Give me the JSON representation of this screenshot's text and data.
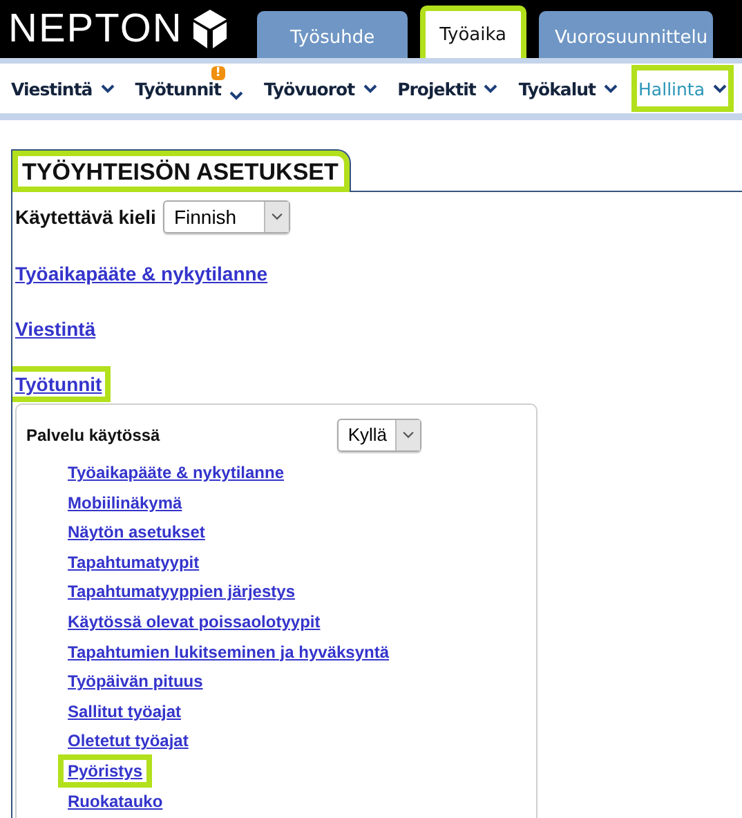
{
  "header": {
    "logo": "NEPTON",
    "tabs": [
      {
        "label": "Työsuhde",
        "selected": false,
        "highlighted": false
      },
      {
        "label": "Työaika",
        "selected": true,
        "highlighted": true
      },
      {
        "label": "Vuorosuunnittelu",
        "selected": false,
        "highlighted": false
      }
    ]
  },
  "menu": [
    {
      "label": "Viestintä",
      "selected": false,
      "highlighted": false
    },
    {
      "label": "Työtunnit",
      "selected": false,
      "highlighted": false,
      "badge": "!"
    },
    {
      "label": "Työvuorot",
      "selected": false,
      "highlighted": false
    },
    {
      "label": "Projektit",
      "selected": false,
      "highlighted": false
    },
    {
      "label": "Työkalut",
      "selected": false,
      "highlighted": false
    },
    {
      "label": "Hallinta",
      "selected": true,
      "highlighted": true
    }
  ],
  "panel": {
    "title": "TYÖYHTEISÖN ASETUKSET",
    "title_highlighted": true,
    "language": {
      "label": "Käytettävä kieli",
      "value": "Finnish"
    },
    "sections": [
      {
        "label": "Työaikapääte & nykytilanne",
        "highlighted": false
      },
      {
        "label": "Viestintä",
        "highlighted": false
      },
      {
        "label": "Työtunnit",
        "highlighted": true
      }
    ],
    "subsection": {
      "service": {
        "label": "Palvelu käytössä",
        "value": "Kyllä"
      },
      "links": [
        {
          "label": "Työaikapääte & nykytilanne",
          "highlighted": false
        },
        {
          "label": "Mobiilinäkymä",
          "highlighted": false
        },
        {
          "label": "Näytön asetukset",
          "highlighted": false
        },
        {
          "label": "Tapahtumatyypit",
          "highlighted": false
        },
        {
          "label": "Tapahtumatyyppien järjestys",
          "highlighted": false
        },
        {
          "label": "Käytössä olevat poissaolotyypit",
          "highlighted": false
        },
        {
          "label": "Tapahtumien lukitseminen ja hyväksyntä",
          "highlighted": false
        },
        {
          "label": "Työpäivän pituus",
          "highlighted": false
        },
        {
          "label": "Sallitut työajat",
          "highlighted": false
        },
        {
          "label": "Oletetut työajat",
          "highlighted": false
        },
        {
          "label": "Pyöristys",
          "highlighted": true
        },
        {
          "label": "Ruokatauko",
          "highlighted": false
        }
      ]
    }
  }
}
